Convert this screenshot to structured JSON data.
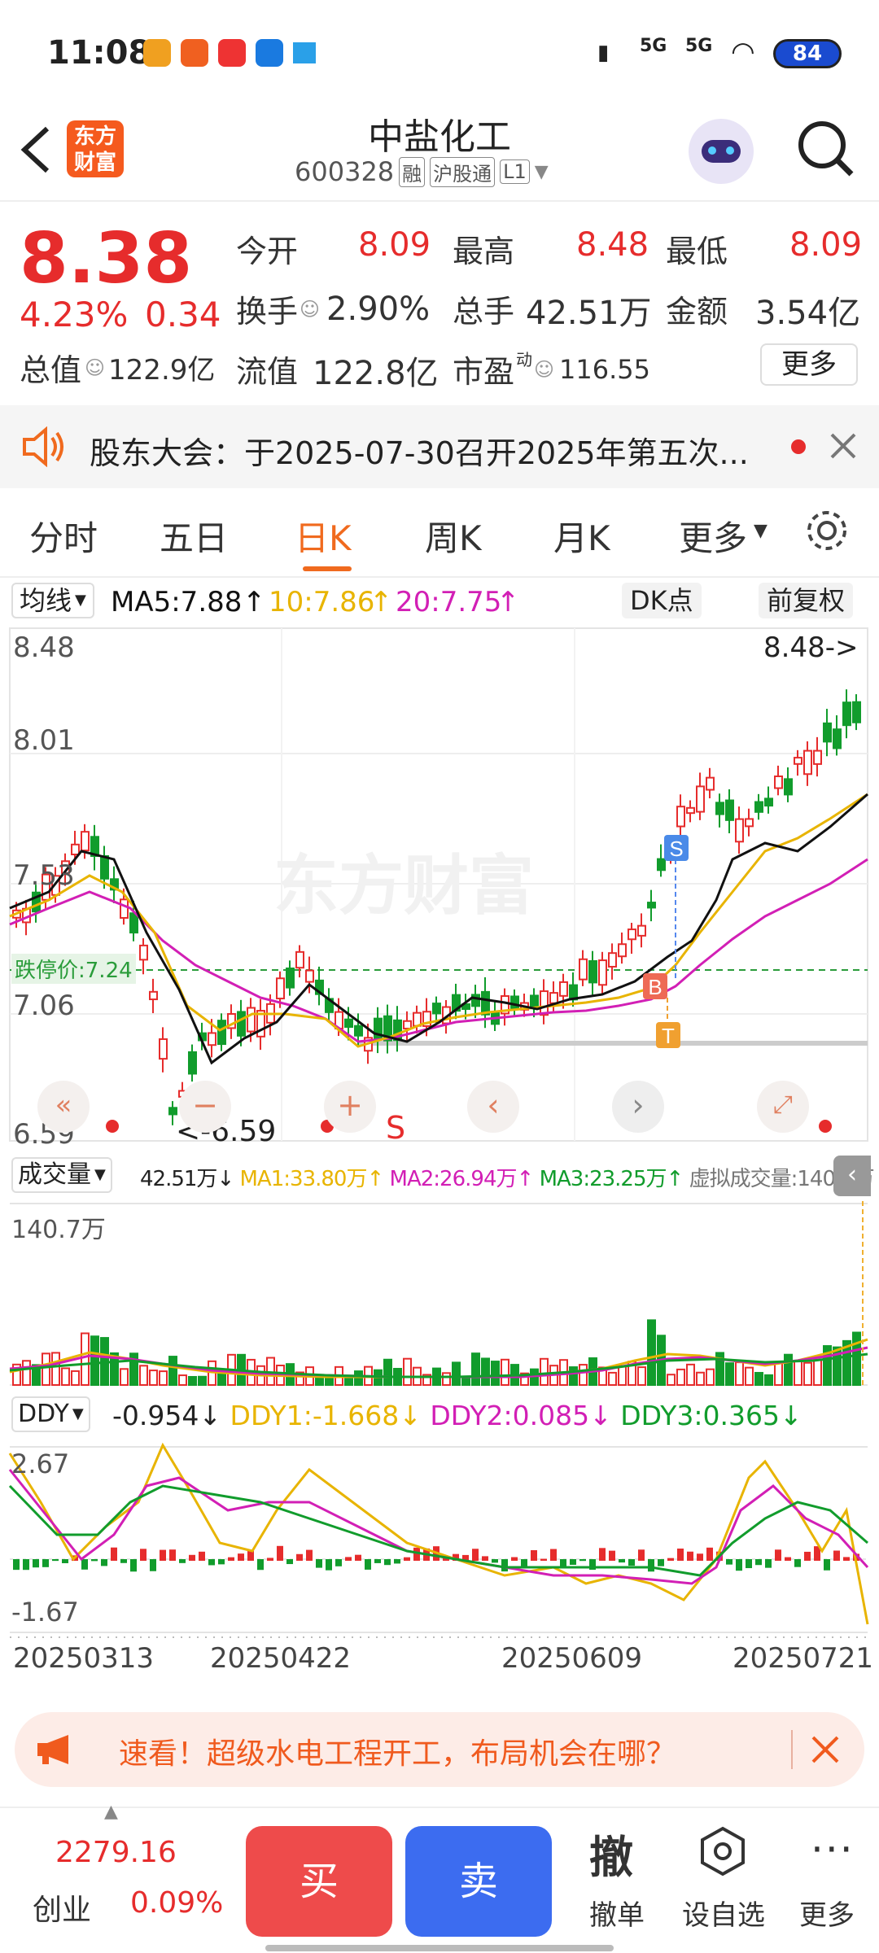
{
  "status": {
    "time": "11:08",
    "net1": "5G",
    "net2": "5G",
    "battery": "84"
  },
  "header": {
    "title": "中盐化工",
    "code": "600328",
    "tag1": "融",
    "tag2": "沪股通",
    "tag3": "L1",
    "logo_line1": "东方",
    "logo_line2": "财富"
  },
  "quote": {
    "price": "8.38",
    "change_pct": "4.23%",
    "change": "0.34",
    "open_label": "今开",
    "open": "8.09",
    "high_label": "最高",
    "high": "8.48",
    "low_label": "最低",
    "low": "8.09",
    "turnover_label": "换手",
    "turnover": "2.90%",
    "volume_label": "总手",
    "volume": "42.51万",
    "amount_label": "金额",
    "amount": "3.54亿",
    "mcap_label": "总值",
    "mcap": "122.9亿",
    "float_label": "流值",
    "float": "122.8亿",
    "pe_label": "市盈",
    "pe_sup": "动",
    "pe": "116.55",
    "more": "更多"
  },
  "notice": {
    "text": "股东大会：于2025-07-30召开2025年第五次..."
  },
  "tabs": [
    "分时",
    "五日",
    "日K",
    "周K",
    "月K",
    "更多"
  ],
  "active_tab": "日K",
  "ma": {
    "selector": "均线",
    "ma5": "MA5:7.88",
    "ma10": "10:7.86",
    "ma20": "20:7.75",
    "dk": "DK点",
    "adjust": "前复权"
  },
  "price_chart": {
    "y_labels": [
      "8.48",
      "8.01",
      "7.53",
      "7.06",
      "6.59"
    ],
    "limit_down": "跌停价:7.24",
    "hi_marker": "8.48->",
    "lo_marker": "<-6.59",
    "signal_s": "S",
    "signal_b": "B",
    "signal_t": "T",
    "watermark": "东方财富",
    "s_label": "S"
  },
  "volume": {
    "selector": "成交量",
    "vol": "42.51万",
    "ma1": "MA1:33.80万",
    "ma2": "MA2:26.94万",
    "ma3": "MA3:23.25万",
    "virtual": "虚拟成交量:140.7万",
    "ymax": "140.7万"
  },
  "ddy": {
    "selector": "DDY",
    "val": "-0.954",
    "d1": "DDY1:-1.668",
    "d2": "DDY2:0.085",
    "d3": "DDY3:0.365",
    "ymax": "2.67",
    "ymin": "-1.67"
  },
  "dates": [
    "20250313",
    "20250422",
    "20250609",
    "20250721"
  ],
  "promo": {
    "text": "速看！超级水电工程开工，布局机会在哪？"
  },
  "bottom": {
    "index_val": "2279.16",
    "index_name": "创业",
    "index_pct": "0.09%",
    "buy": "买",
    "sell": "卖",
    "cancel_icon": "撤",
    "cancel": "撤单",
    "watch": "设自选",
    "more": "更多"
  },
  "colors": {
    "up": "#e62c2c",
    "down": "#119c2c",
    "ma5": "#111111",
    "ma10": "#e8b400",
    "ma20": "#d21fb5",
    "buy": "#ee4b4b",
    "sell": "#3c6cf0"
  },
  "chart_data": {
    "type": "candlestick",
    "x_range": [
      "20250313",
      "20250721"
    ],
    "price_range": [
      6.59,
      8.48
    ],
    "price_points": [
      {
        "date": "20250313",
        "close": 7.45
      },
      {
        "date": "20250401",
        "close": 7.45
      },
      {
        "date": "20250408",
        "close": 6.8
      },
      {
        "date": "20250422",
        "close": 7.0
      },
      {
        "date": "20250609",
        "close": 7.06
      },
      {
        "date": "20250626",
        "close": 7.3
      },
      {
        "date": "20250721",
        "close": 8.38
      }
    ]
  }
}
